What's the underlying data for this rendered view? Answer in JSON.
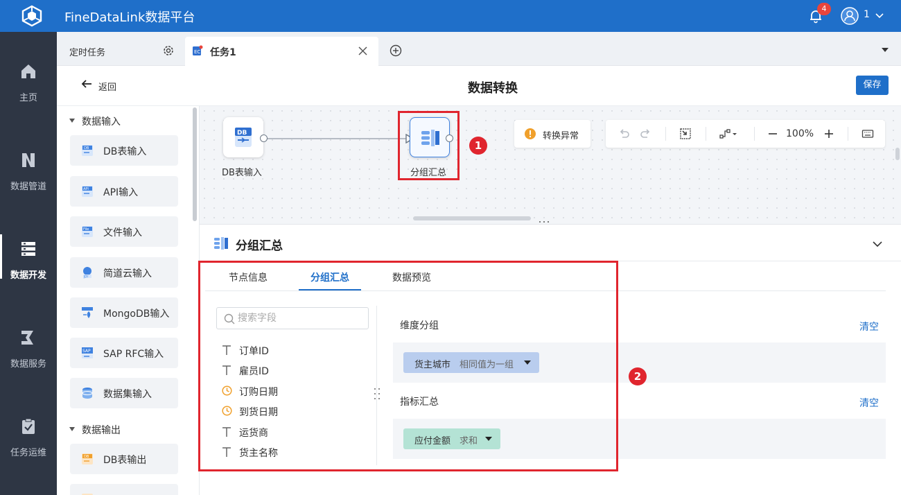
{
  "app": {
    "title": "FineDataLink数据平台",
    "notifications": "4",
    "user": "1"
  },
  "colors": {
    "primary": "#1f6fc9",
    "sidebar": "#2e3644",
    "highlight": "#e0252e",
    "dim_chip": "#b9cdee",
    "metric_chip": "#b4e3d5"
  },
  "sidebar": {
    "items": [
      {
        "label": "主页",
        "icon": "home-icon"
      },
      {
        "label": "数据管道",
        "icon": "pipeline-icon"
      },
      {
        "label": "数据开发",
        "icon": "dev-icon",
        "active": true
      },
      {
        "label": "数据服务",
        "icon": "service-icon"
      },
      {
        "label": "任务运维",
        "icon": "ops-icon"
      }
    ]
  },
  "tabs": {
    "scheduled": "定时任务",
    "active_tab": "任务1"
  },
  "header": {
    "back": "返回",
    "title": "数据转换",
    "save": "保存"
  },
  "palette": {
    "input_group": "数据输入",
    "inputs": [
      "DB表输入",
      "API输入",
      "文件输入",
      "简道云输入",
      "MongoDB输入",
      "SAP RFC输入",
      "数据集输入"
    ],
    "output_group": "数据输出",
    "outputs": [
      "DB表输出"
    ]
  },
  "canvas": {
    "nodes": [
      {
        "label": "DB表输入",
        "icon": "db-icon"
      },
      {
        "label": "分组汇总",
        "icon": "group-summary-icon"
      }
    ],
    "warning": "转换异常",
    "zoom": "100%",
    "annotations": [
      "1",
      "2"
    ]
  },
  "panel": {
    "title": "分组汇总",
    "tabs": [
      "节点信息",
      "分组汇总",
      "数据预览"
    ],
    "active_tab": 1,
    "search_placeholder": "搜索字段",
    "fields": [
      {
        "name": "订单ID",
        "type": "text"
      },
      {
        "name": "雇员ID",
        "type": "text"
      },
      {
        "name": "订购日期",
        "type": "date"
      },
      {
        "name": "到货日期",
        "type": "date"
      },
      {
        "name": "运货商",
        "type": "text"
      },
      {
        "name": "货主名称",
        "type": "text"
      }
    ],
    "dimension": {
      "title": "维度分组",
      "clear": "清空",
      "chip_field": "货主城市",
      "chip_mode": "相同值为一组"
    },
    "metric": {
      "title": "指标汇总",
      "clear": "清空",
      "chip_field": "应付金额",
      "chip_mode": "求和"
    }
  }
}
